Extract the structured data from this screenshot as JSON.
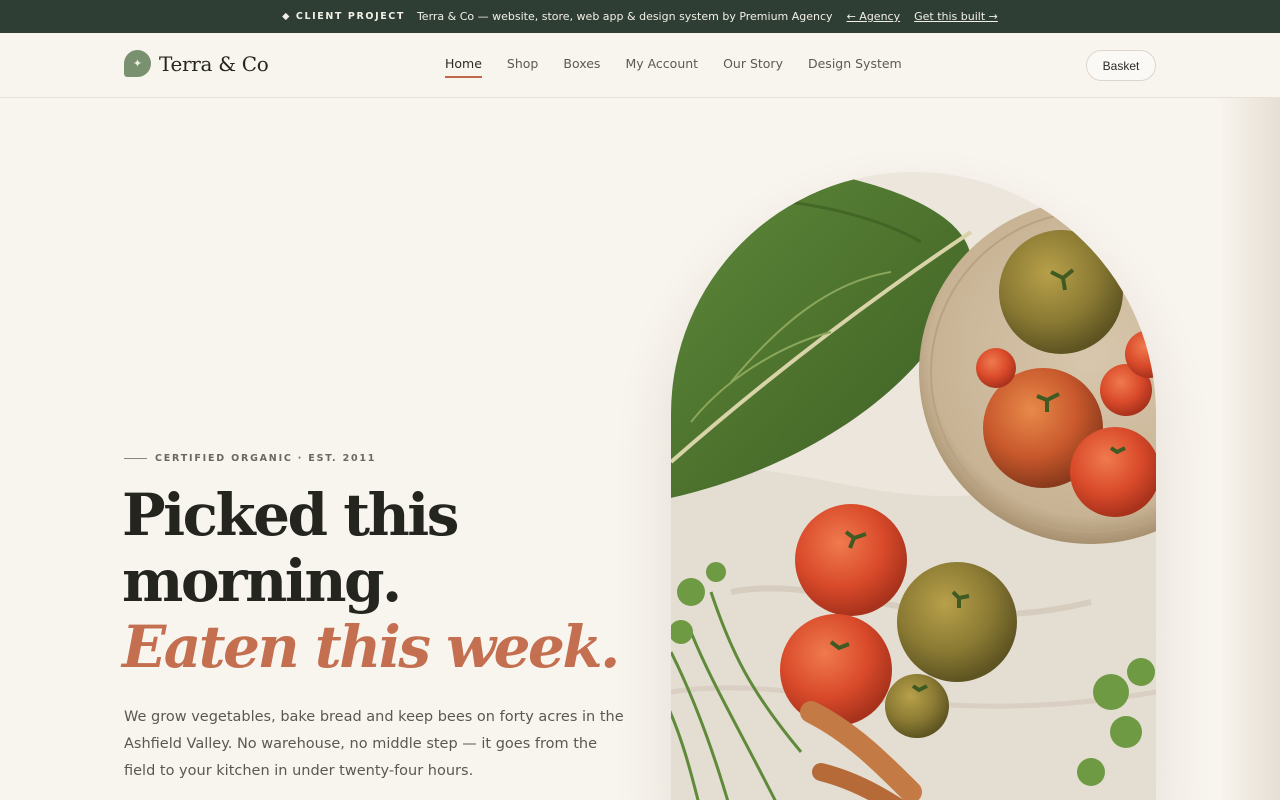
{
  "banner": {
    "tag": "◆ CLIENT PROJECT",
    "description": "Terra & Co — website, store, web app & design system by Premium Agency",
    "agency_link": "← Agency",
    "cta_link": "Get this built →"
  },
  "header": {
    "logo_glyph": "✦",
    "brand": "Terra & Co",
    "nav": [
      {
        "label": "Home",
        "active": true
      },
      {
        "label": "Shop",
        "active": false
      },
      {
        "label": "Boxes",
        "active": false
      },
      {
        "label": "My Account",
        "active": false
      },
      {
        "label": "Our Story",
        "active": false
      },
      {
        "label": "Design System",
        "active": false
      }
    ],
    "basket_label": "Basket"
  },
  "hero": {
    "eyebrow": "CERTIFIED ORGANIC · EST. 2011",
    "headline_line1": "Picked this",
    "headline_line2": "morning.",
    "headline_accent": "Eaten this week.",
    "lede": "We grow vegetables, bake bread and keep bees on forty acres in the Ashfield Valley. No warehouse, no middle step — it goes from the field to your kitchen in under twenty-four hours."
  },
  "colors": {
    "banner_bg": "#2e3e34",
    "page_bg": "#f8f4ee",
    "accent": "#c36f50",
    "brand_green": "#7a9170"
  },
  "icons": {
    "logo": "leaf-icon",
    "hero_image": "vegetables-photo"
  }
}
